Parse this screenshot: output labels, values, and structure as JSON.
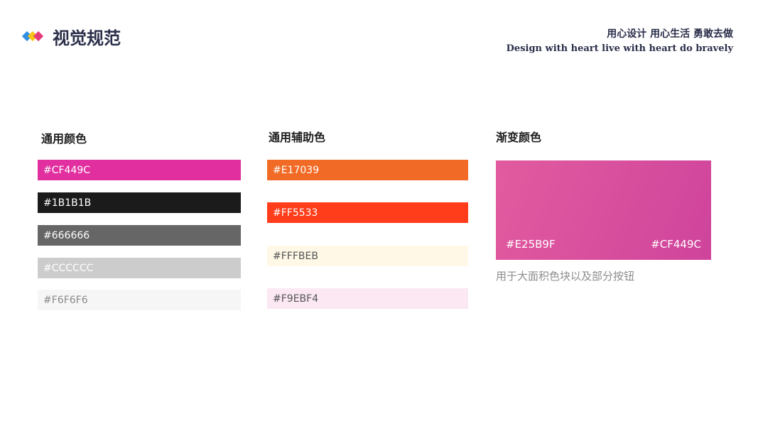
{
  "header": {
    "title": "视觉规范",
    "slogan_cn": "用心设计 用心生活 勇敢去做",
    "slogan_en": "Design with heart  live with heart  do bravely"
  },
  "sections": {
    "primary": {
      "title": "通用颜色",
      "swatches": [
        {
          "label": "#CF449C",
          "color": "#E12FA0",
          "text_color": "#ffffff"
        },
        {
          "label": "#1B1B1B",
          "color": "#1B1B1B",
          "text_color": "#ffffff"
        },
        {
          "label": "#666666",
          "color": "#666666",
          "text_color": "#ffffff"
        },
        {
          "label": "#CCCCCC",
          "color": "#CCCCCC",
          "text_color": "#ffffff"
        },
        {
          "label": "#F6F6F6",
          "color": "#F6F6F6",
          "text_color": "#8a8a8a"
        }
      ]
    },
    "secondary": {
      "title": "通用辅助色",
      "swatches": [
        {
          "label": "#E17039",
          "color": "#F26B26",
          "text_color": "#ffffff"
        },
        {
          "label": "#FF5533",
          "color": "#FF3D1A",
          "text_color": "#ffffff"
        },
        {
          "label": "#FFFBEB",
          "color": "#FFF8E7",
          "text_color": "#555555"
        },
        {
          "label": "#F9EBF4",
          "color": "#FBE8F3",
          "text_color": "#555555"
        }
      ]
    },
    "gradient": {
      "title": "渐变颜色",
      "start_label": "#E25B9F",
      "end_label": "#CF449C",
      "start_color": "#E25B9F",
      "end_color": "#CF449C",
      "note": "用于大面积色块以及部分按钮"
    }
  }
}
